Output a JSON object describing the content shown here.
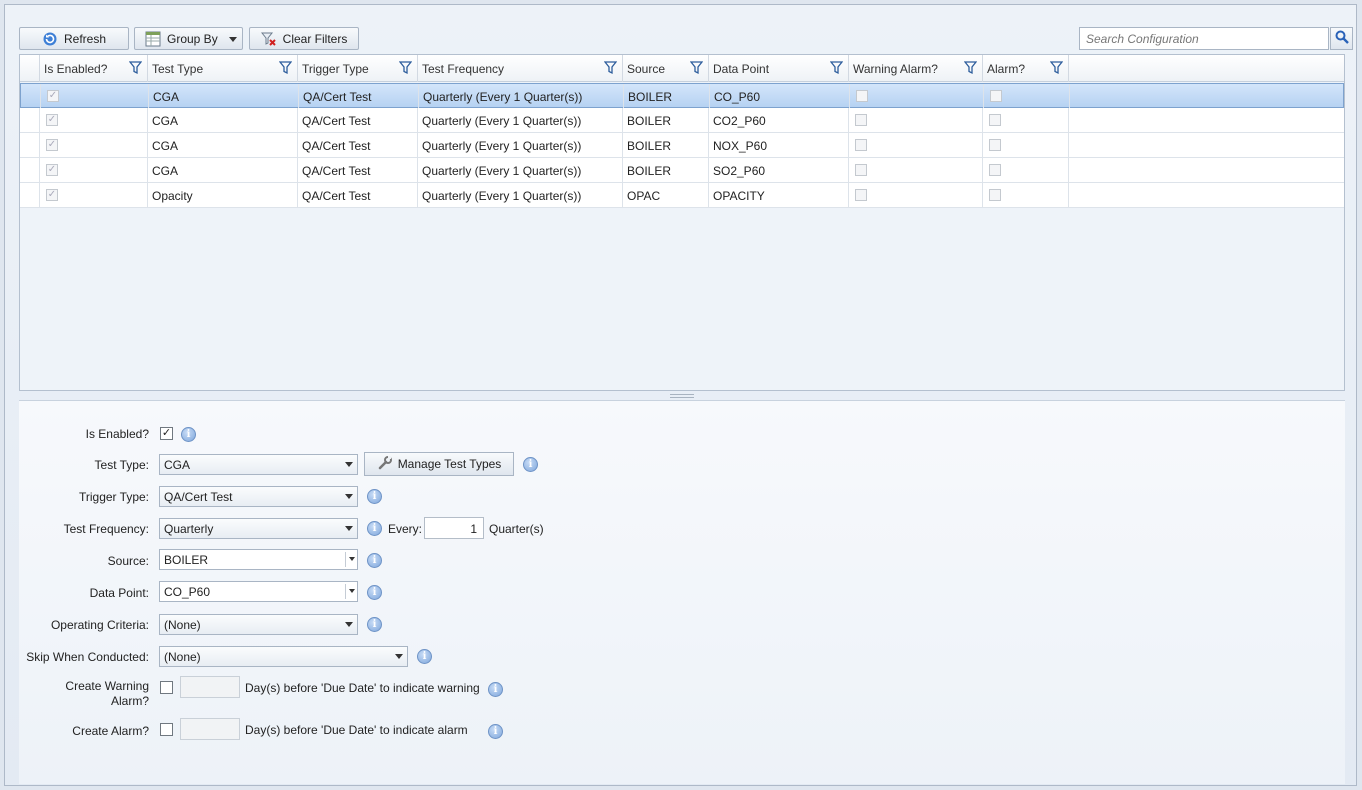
{
  "toolbar": {
    "refresh_label": "Refresh",
    "group_by_label": "Group By",
    "clear_filters_label": "Clear Filters",
    "search_placeholder": "Search Configuration"
  },
  "grid": {
    "columns": [
      {
        "label": "Is Enabled?"
      },
      {
        "label": "Test Type"
      },
      {
        "label": "Trigger Type"
      },
      {
        "label": "Test Frequency"
      },
      {
        "label": "Source"
      },
      {
        "label": "Data Point"
      },
      {
        "label": "Warning Alarm?"
      },
      {
        "label": "Alarm?"
      }
    ],
    "rows": [
      {
        "is_enabled": true,
        "test_type": "CGA",
        "trigger_type": "QA/Cert Test",
        "test_frequency": "Quarterly (Every 1 Quarter(s))",
        "source": "BOILER",
        "data_point": "CO_P60",
        "warning_alarm": false,
        "alarm": false,
        "selected": true
      },
      {
        "is_enabled": true,
        "test_type": "CGA",
        "trigger_type": "QA/Cert Test",
        "test_frequency": "Quarterly (Every 1 Quarter(s))",
        "source": "BOILER",
        "data_point": "CO2_P60",
        "warning_alarm": false,
        "alarm": false,
        "selected": false
      },
      {
        "is_enabled": true,
        "test_type": "CGA",
        "trigger_type": "QA/Cert Test",
        "test_frequency": "Quarterly (Every 1 Quarter(s))",
        "source": "BOILER",
        "data_point": "NOX_P60",
        "warning_alarm": false,
        "alarm": false,
        "selected": false
      },
      {
        "is_enabled": true,
        "test_type": "CGA",
        "trigger_type": "QA/Cert Test",
        "test_frequency": "Quarterly (Every 1 Quarter(s))",
        "source": "BOILER",
        "data_point": "SO2_P60",
        "warning_alarm": false,
        "alarm": false,
        "selected": false
      },
      {
        "is_enabled": true,
        "test_type": "Opacity",
        "trigger_type": "QA/Cert Test",
        "test_frequency": "Quarterly (Every 1 Quarter(s))",
        "source": "OPAC",
        "data_point": "OPACITY",
        "warning_alarm": false,
        "alarm": false,
        "selected": false
      }
    ]
  },
  "form": {
    "is_enabled_label": "Is Enabled?",
    "is_enabled": true,
    "test_type_label": "Test Type:",
    "test_type_value": "CGA",
    "manage_test_types_label": "Manage Test Types",
    "trigger_type_label": "Trigger Type:",
    "trigger_type_value": "QA/Cert Test",
    "test_frequency_label": "Test Frequency:",
    "test_frequency_value": "Quarterly",
    "every_label": "Every:",
    "every_value": "1",
    "every_unit": "Quarter(s)",
    "source_label": "Source:",
    "source_value": "BOILER",
    "data_point_label": "Data Point:",
    "data_point_value": "CO_P60",
    "operating_criteria_label": "Operating Criteria:",
    "operating_criteria_value": "(None)",
    "skip_when_conducted_label": "Skip When Conducted:",
    "skip_when_conducted_value": "(None)",
    "create_warning_label_1": "Create Warning",
    "create_warning_label_2": "Alarm?",
    "create_warning_checked": false,
    "create_warning_days": "",
    "create_warning_suffix": "Day(s) before 'Due Date' to indicate warning",
    "create_alarm_label": "Create Alarm?",
    "create_alarm_checked": false,
    "create_alarm_days": "",
    "create_alarm_suffix": "Day(s) before 'Due Date' to indicate alarm"
  },
  "colors": {
    "selection": "#b6d2f2",
    "info_icon": "#7fa7dc",
    "refresh_icon": "#3d7fd6",
    "clear_filter_icon": "#d02020"
  }
}
